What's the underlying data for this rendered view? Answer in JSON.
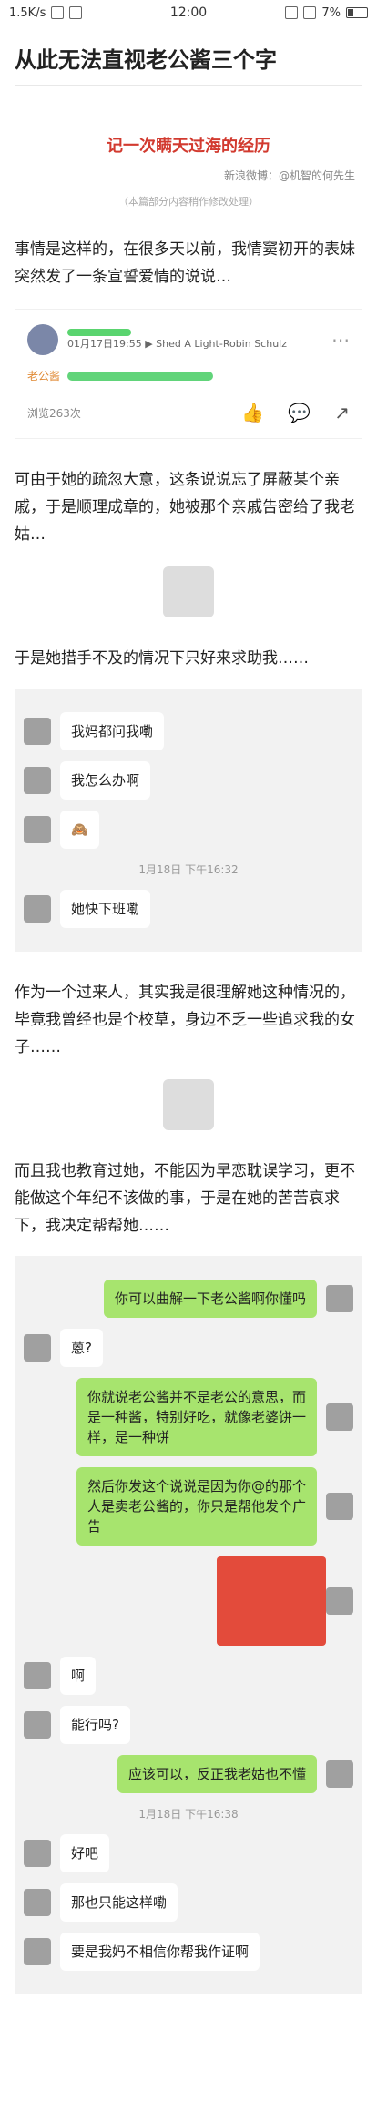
{
  "status": {
    "network": "1.5K/s",
    "time": "12:00",
    "battery": "7%"
  },
  "article": {
    "title": "从此无法直视老公酱三个字",
    "banner_title": "记一次瞒天过海的经历",
    "banner_source": "新浪微博：@机智的何先生",
    "banner_note": "（本篇部分内容稍作修改处理）",
    "p1": "事情是这样的，在很多天以前，我情窦初开的表妹突然发了一条宣誓爱情的说说…",
    "p2": "可由于她的疏忽大意，这条说说忘了屏蔽某个亲戚，于是顺理成章的，她被那个亲戚告密给了我老姑…",
    "p3": "于是她措手不及的情况下只好来求助我……",
    "p4": "作为一个过来人，其实我是很理解她这种情况的，毕竟我曾经也是个校草，身边不乏一些追求我的女子……",
    "p5": "而且我也教育过她，不能因为早恋耽误学习，更不能做这个年纪不该做的事，于是在她的苦苦哀求下，我决定帮帮她……"
  },
  "post": {
    "date": "01月17日19:55",
    "song": "Shed A Light-Robin Schulz",
    "status_prefix": "老公酱",
    "views": "浏览263次"
  },
  "chat1": {
    "msgs": [
      {
        "side": "left",
        "text": "我妈都问我嘞"
      },
      {
        "side": "left",
        "text": "我怎么办啊"
      },
      {
        "side": "left",
        "text": "🙈"
      },
      {
        "side": "time",
        "text": "1月18日 下午16:32"
      },
      {
        "side": "left",
        "text": "她快下班嘞"
      }
    ]
  },
  "chat2": {
    "msgs": [
      {
        "side": "right",
        "text": "你可以曲解一下老公酱啊你懂吗"
      },
      {
        "side": "left",
        "text": "蒽?"
      },
      {
        "side": "right",
        "text": "你就说老公酱并不是老公的意思，而是一种酱，特别好吃，就像老婆饼一样，是一种饼"
      },
      {
        "side": "right",
        "text": "然后你发这个说说是因为你@的那个人是卖老公酱的，你只是帮他发个广告"
      },
      {
        "side": "right",
        "text": "STICKER"
      },
      {
        "side": "left",
        "text": "啊"
      },
      {
        "side": "left",
        "text": "能行吗?"
      },
      {
        "side": "right",
        "text": "应该可以，反正我老姑也不懂"
      },
      {
        "side": "time",
        "text": "1月18日 下午16:38"
      },
      {
        "side": "left",
        "text": "好吧"
      },
      {
        "side": "left",
        "text": "那也只能这样嘞"
      },
      {
        "side": "left",
        "text": "要是我妈不相信你帮我作证啊"
      }
    ]
  }
}
